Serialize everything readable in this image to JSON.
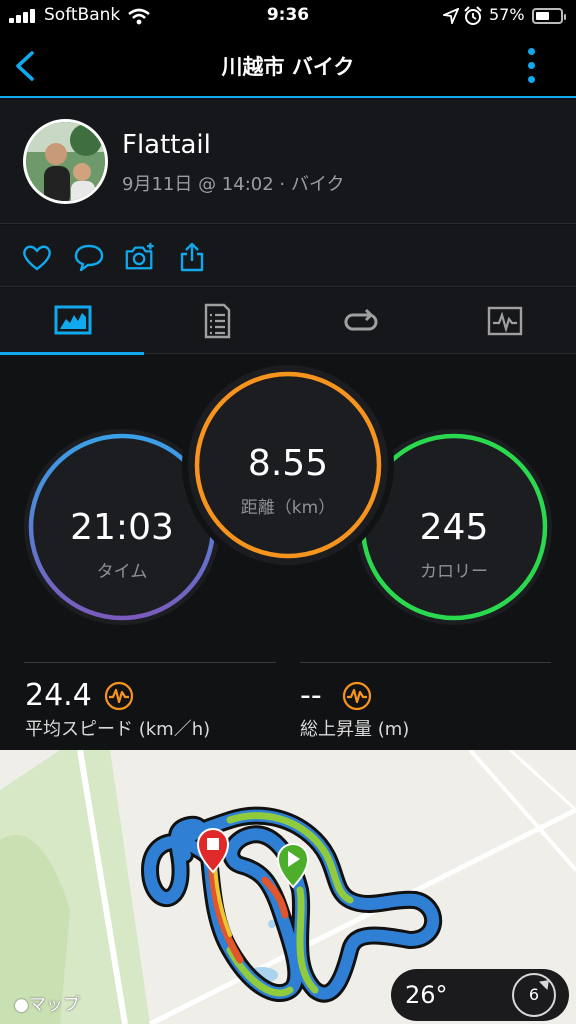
{
  "status_bar": {
    "carrier": "SoftBank",
    "time": "9:36",
    "battery": "57%",
    "battery_level": 0.57
  },
  "nav": {
    "title": "川越市 バイク"
  },
  "activity": {
    "user_name": "Flattail",
    "meta": "9月11日 @ 14:02 · バイク"
  },
  "stats": {
    "distance": {
      "value": "8.55",
      "label": "距離（km）",
      "color": "#f7941d"
    },
    "time": {
      "value": "21:03",
      "label": "タイム",
      "color_from": "#3aa0e8",
      "color_to": "#7a5bbd"
    },
    "calories": {
      "value": "245",
      "label": "カロリー",
      "color": "#2bd94f"
    },
    "avg_speed": {
      "value": "24.4",
      "label": "平均スピード (km／h)"
    },
    "total_ascent": {
      "value": "--",
      "label": "総上昇量 (m)"
    }
  },
  "map": {
    "logo": "マップ",
    "temperature": "26°",
    "wind": "6"
  },
  "colors": {
    "accent": "#11a9ed",
    "pulse_icon": "#f7941d"
  }
}
